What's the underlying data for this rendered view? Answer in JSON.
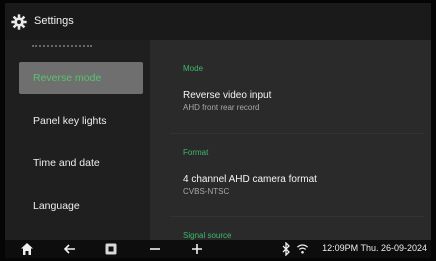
{
  "header": {
    "title": "Settings",
    "icon": "gear-icon"
  },
  "sidebar": {
    "items": [
      {
        "label": "Reverse mode",
        "active": true
      },
      {
        "label": "Panel key lights",
        "active": false
      },
      {
        "label": "Time and date",
        "active": false
      },
      {
        "label": "Language",
        "active": false
      }
    ]
  },
  "main": {
    "sections": [
      {
        "label": "Mode",
        "title": "Reverse video input",
        "subtitle": "AHD front rear record"
      },
      {
        "label": "Format",
        "title": "4 channel AHD camera format",
        "subtitle": "CVBS-NTSC"
      },
      {
        "label": "Signal source"
      }
    ]
  },
  "navbar": {
    "icons": [
      "home-icon",
      "back-icon",
      "recent-apps-icon",
      "volume-down-icon",
      "volume-up-icon",
      "bluetooth-icon",
      "wifi-icon"
    ],
    "clock": "12:09PM Thu. 26-09-2024"
  },
  "colors": {
    "accent": "#3fb86a",
    "active_bg": "#6f6f6f",
    "screen_bg": "#262626"
  }
}
